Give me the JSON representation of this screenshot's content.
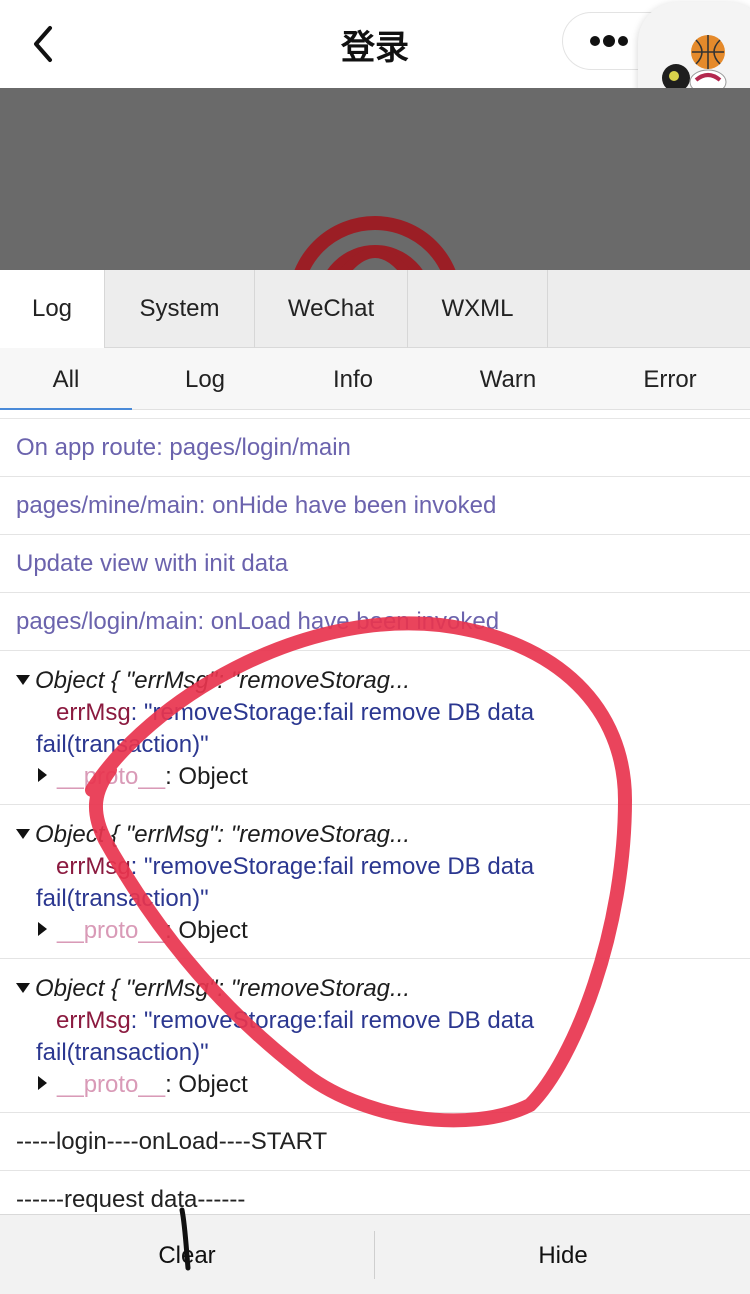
{
  "navbar": {
    "title": "登录",
    "back_icon": "chevron-left-icon",
    "menu_icon": "more-dots-icon"
  },
  "tabs": [
    {
      "label": "Log",
      "active": true
    },
    {
      "label": "System",
      "active": false
    },
    {
      "label": "WeChat",
      "active": false
    },
    {
      "label": "WXML",
      "active": false
    }
  ],
  "filters": [
    {
      "label": "All",
      "active": true
    },
    {
      "label": "Log",
      "active": false
    },
    {
      "label": "Info",
      "active": false
    },
    {
      "label": "Warn",
      "active": false
    },
    {
      "label": "Error",
      "active": false
    }
  ],
  "logs": {
    "system_1": "On app route: pages/login/main",
    "system_2": "pages/mine/main: onHide have been invoked",
    "system_3": "Update view with init data",
    "system_4": "pages/login/main: onLoad have been invoked",
    "object_head": "Object { \"errMsg\": \"removeStorag...",
    "object_key": "errMsg",
    "object_sep": ": ",
    "object_value_line1": "\"removeStorage:fail remove DB data",
    "object_value_line2": "fail(transaction)\"",
    "proto_key": "__proto__",
    "proto_value": ": Object",
    "plain_1": "-----login----onLoad----START",
    "plain_2": "------request data------"
  },
  "buttons": {
    "clear": "Clear",
    "hide": "Hide"
  },
  "colors": {
    "system_log": "#6b63ad",
    "object_key": "#8b1a3f",
    "object_value": "#2b3790",
    "proto": "#d99ab7",
    "annotation": "#e8344e",
    "active_filter_underline": "#4a8ad8"
  }
}
